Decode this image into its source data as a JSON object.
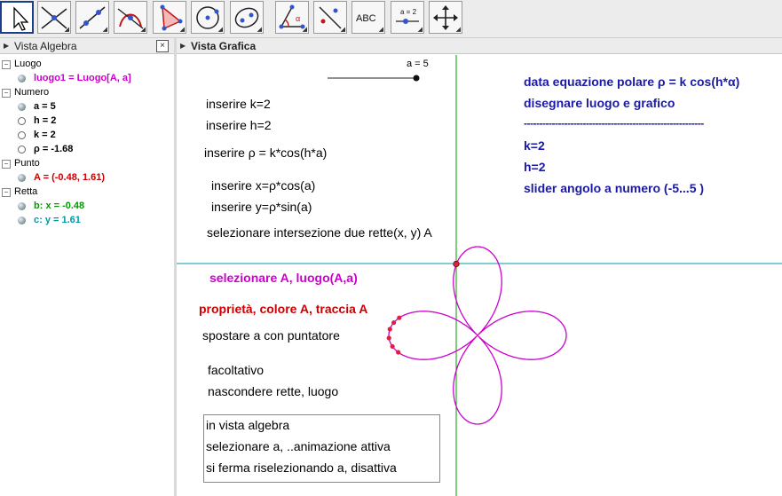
{
  "toolbar": {
    "tools": [
      {
        "name": "move-tool-icon",
        "label": ""
      },
      {
        "name": "intersect-point-tool-icon",
        "label": ""
      },
      {
        "name": "line-tool-icon",
        "label": ""
      },
      {
        "name": "perpendicular-tool-icon",
        "label": ""
      },
      {
        "name": "polygon-tool-icon",
        "label": ""
      },
      {
        "name": "circle-tool-icon",
        "label": ""
      },
      {
        "name": "ellipse-tool-icon",
        "label": ""
      },
      {
        "name": "angle-tool-icon",
        "label": "α"
      },
      {
        "name": "reflect-tool-icon",
        "label": ""
      },
      {
        "name": "text-tool-icon",
        "label": "ABC"
      },
      {
        "name": "slider-tool-icon",
        "label": "a = 2"
      },
      {
        "name": "move-view-tool-icon",
        "label": ""
      }
    ]
  },
  "algebra_view": {
    "title": "Vista Algebra",
    "close_symbol": "×",
    "groups": [
      {
        "label": "Luogo",
        "items": [
          {
            "text": "luogo1 = Luogo[A, a]",
            "color": "#cc00cc",
            "bullet": "filled"
          }
        ]
      },
      {
        "label": "Numero",
        "items": [
          {
            "text": "a = 5",
            "color": "#000000",
            "bullet": "filled"
          },
          {
            "text": "h = 2",
            "color": "#000000",
            "bullet": "hollow"
          },
          {
            "text": "k = 2",
            "color": "#000000",
            "bullet": "hollow"
          },
          {
            "text": "ρ = -1.68",
            "color": "#000000",
            "bullet": "hollow"
          }
        ]
      },
      {
        "label": "Punto",
        "items": [
          {
            "text": "A = (-0.48, 1.61)",
            "color": "#cc0000",
            "bullet": "filled"
          }
        ]
      },
      {
        "label": "Retta",
        "items": [
          {
            "text": "b: x = -0.48",
            "color": "#009900",
            "bullet": "filled"
          },
          {
            "text": "c: y = 1.61",
            "color": "#0099aa",
            "bullet": "filled"
          }
        ]
      }
    ]
  },
  "graphics_view": {
    "title": "Vista Grafica",
    "slider_label": "a = 5",
    "instructions": [
      {
        "text": "inserire k=2",
        "color": "#000000"
      },
      {
        "text": "inserire h=2",
        "color": "#000000"
      },
      {
        "text": "inserire ρ = k*cos(h*a)",
        "color": "#000000"
      },
      {
        "text": "inserire x=ρ*cos(a)",
        "color": "#000000"
      },
      {
        "text": "inserire y=ρ*sin(a)",
        "color": "#000000"
      },
      {
        "text": "selezionare intersezione due rette(x, y) A",
        "color": "#000000"
      },
      {
        "text": "selezionare A, luogo(A,a)",
        "color": "#cc00cc"
      },
      {
        "text": "proprietà, colore A, traccia A",
        "color": "#cc0000"
      },
      {
        "text": "spostare a con puntatore",
        "color": "#000000"
      },
      {
        "text": "facoltativo",
        "color": "#000000"
      },
      {
        "text": "nascondere rette, luogo",
        "color": "#000000"
      }
    ],
    "box_lines": [
      "in vista algebra",
      "selezionare a, ..animazione attiva",
      "si ferma riselezionando a, disattiva"
    ],
    "right_notes": [
      "data equazione polare ρ = k cos(h*α)",
      "disegnare luogo e grafico",
      "----------------------------------------------------------",
      "k=2",
      "h=2",
      "slider angolo a numero (-5...5 )"
    ],
    "right_notes_color": "#1a1aa6",
    "curve": {
      "k": 2,
      "h": 2,
      "a": 5,
      "point_A": [
        -0.48,
        1.61
      ]
    },
    "colors": {
      "locus": "#cc00cc",
      "trace": "#e02040",
      "line_b": "#009900",
      "line_c": "#0099aa"
    }
  }
}
